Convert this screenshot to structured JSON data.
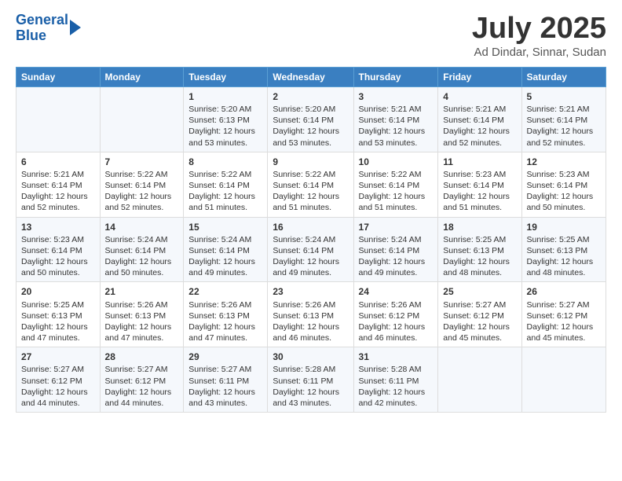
{
  "header": {
    "logo_line1": "General",
    "logo_line2": "Blue",
    "month_title": "July 2025",
    "location": "Ad Dindar, Sinnar, Sudan"
  },
  "days_of_week": [
    "Sunday",
    "Monday",
    "Tuesday",
    "Wednesday",
    "Thursday",
    "Friday",
    "Saturday"
  ],
  "weeks": [
    [
      {
        "day": "",
        "sunrise": "",
        "sunset": "",
        "daylight": ""
      },
      {
        "day": "",
        "sunrise": "",
        "sunset": "",
        "daylight": ""
      },
      {
        "day": "1",
        "sunrise": "Sunrise: 5:20 AM",
        "sunset": "Sunset: 6:13 PM",
        "daylight": "Daylight: 12 hours and 53 minutes."
      },
      {
        "day": "2",
        "sunrise": "Sunrise: 5:20 AM",
        "sunset": "Sunset: 6:14 PM",
        "daylight": "Daylight: 12 hours and 53 minutes."
      },
      {
        "day": "3",
        "sunrise": "Sunrise: 5:21 AM",
        "sunset": "Sunset: 6:14 PM",
        "daylight": "Daylight: 12 hours and 53 minutes."
      },
      {
        "day": "4",
        "sunrise": "Sunrise: 5:21 AM",
        "sunset": "Sunset: 6:14 PM",
        "daylight": "Daylight: 12 hours and 52 minutes."
      },
      {
        "day": "5",
        "sunrise": "Sunrise: 5:21 AM",
        "sunset": "Sunset: 6:14 PM",
        "daylight": "Daylight: 12 hours and 52 minutes."
      }
    ],
    [
      {
        "day": "6",
        "sunrise": "Sunrise: 5:21 AM",
        "sunset": "Sunset: 6:14 PM",
        "daylight": "Daylight: 12 hours and 52 minutes."
      },
      {
        "day": "7",
        "sunrise": "Sunrise: 5:22 AM",
        "sunset": "Sunset: 6:14 PM",
        "daylight": "Daylight: 12 hours and 52 minutes."
      },
      {
        "day": "8",
        "sunrise": "Sunrise: 5:22 AM",
        "sunset": "Sunset: 6:14 PM",
        "daylight": "Daylight: 12 hours and 51 minutes."
      },
      {
        "day": "9",
        "sunrise": "Sunrise: 5:22 AM",
        "sunset": "Sunset: 6:14 PM",
        "daylight": "Daylight: 12 hours and 51 minutes."
      },
      {
        "day": "10",
        "sunrise": "Sunrise: 5:22 AM",
        "sunset": "Sunset: 6:14 PM",
        "daylight": "Daylight: 12 hours and 51 minutes."
      },
      {
        "day": "11",
        "sunrise": "Sunrise: 5:23 AM",
        "sunset": "Sunset: 6:14 PM",
        "daylight": "Daylight: 12 hours and 51 minutes."
      },
      {
        "day": "12",
        "sunrise": "Sunrise: 5:23 AM",
        "sunset": "Sunset: 6:14 PM",
        "daylight": "Daylight: 12 hours and 50 minutes."
      }
    ],
    [
      {
        "day": "13",
        "sunrise": "Sunrise: 5:23 AM",
        "sunset": "Sunset: 6:14 PM",
        "daylight": "Daylight: 12 hours and 50 minutes."
      },
      {
        "day": "14",
        "sunrise": "Sunrise: 5:24 AM",
        "sunset": "Sunset: 6:14 PM",
        "daylight": "Daylight: 12 hours and 50 minutes."
      },
      {
        "day": "15",
        "sunrise": "Sunrise: 5:24 AM",
        "sunset": "Sunset: 6:14 PM",
        "daylight": "Daylight: 12 hours and 49 minutes."
      },
      {
        "day": "16",
        "sunrise": "Sunrise: 5:24 AM",
        "sunset": "Sunset: 6:14 PM",
        "daylight": "Daylight: 12 hours and 49 minutes."
      },
      {
        "day": "17",
        "sunrise": "Sunrise: 5:24 AM",
        "sunset": "Sunset: 6:14 PM",
        "daylight": "Daylight: 12 hours and 49 minutes."
      },
      {
        "day": "18",
        "sunrise": "Sunrise: 5:25 AM",
        "sunset": "Sunset: 6:13 PM",
        "daylight": "Daylight: 12 hours and 48 minutes."
      },
      {
        "day": "19",
        "sunrise": "Sunrise: 5:25 AM",
        "sunset": "Sunset: 6:13 PM",
        "daylight": "Daylight: 12 hours and 48 minutes."
      }
    ],
    [
      {
        "day": "20",
        "sunrise": "Sunrise: 5:25 AM",
        "sunset": "Sunset: 6:13 PM",
        "daylight": "Daylight: 12 hours and 47 minutes."
      },
      {
        "day": "21",
        "sunrise": "Sunrise: 5:26 AM",
        "sunset": "Sunset: 6:13 PM",
        "daylight": "Daylight: 12 hours and 47 minutes."
      },
      {
        "day": "22",
        "sunrise": "Sunrise: 5:26 AM",
        "sunset": "Sunset: 6:13 PM",
        "daylight": "Daylight: 12 hours and 47 minutes."
      },
      {
        "day": "23",
        "sunrise": "Sunrise: 5:26 AM",
        "sunset": "Sunset: 6:13 PM",
        "daylight": "Daylight: 12 hours and 46 minutes."
      },
      {
        "day": "24",
        "sunrise": "Sunrise: 5:26 AM",
        "sunset": "Sunset: 6:12 PM",
        "daylight": "Daylight: 12 hours and 46 minutes."
      },
      {
        "day": "25",
        "sunrise": "Sunrise: 5:27 AM",
        "sunset": "Sunset: 6:12 PM",
        "daylight": "Daylight: 12 hours and 45 minutes."
      },
      {
        "day": "26",
        "sunrise": "Sunrise: 5:27 AM",
        "sunset": "Sunset: 6:12 PM",
        "daylight": "Daylight: 12 hours and 45 minutes."
      }
    ],
    [
      {
        "day": "27",
        "sunrise": "Sunrise: 5:27 AM",
        "sunset": "Sunset: 6:12 PM",
        "daylight": "Daylight: 12 hours and 44 minutes."
      },
      {
        "day": "28",
        "sunrise": "Sunrise: 5:27 AM",
        "sunset": "Sunset: 6:12 PM",
        "daylight": "Daylight: 12 hours and 44 minutes."
      },
      {
        "day": "29",
        "sunrise": "Sunrise: 5:27 AM",
        "sunset": "Sunset: 6:11 PM",
        "daylight": "Daylight: 12 hours and 43 minutes."
      },
      {
        "day": "30",
        "sunrise": "Sunrise: 5:28 AM",
        "sunset": "Sunset: 6:11 PM",
        "daylight": "Daylight: 12 hours and 43 minutes."
      },
      {
        "day": "31",
        "sunrise": "Sunrise: 5:28 AM",
        "sunset": "Sunset: 6:11 PM",
        "daylight": "Daylight: 12 hours and 42 minutes."
      },
      {
        "day": "",
        "sunrise": "",
        "sunset": "",
        "daylight": ""
      },
      {
        "day": "",
        "sunrise": "",
        "sunset": "",
        "daylight": ""
      }
    ]
  ]
}
